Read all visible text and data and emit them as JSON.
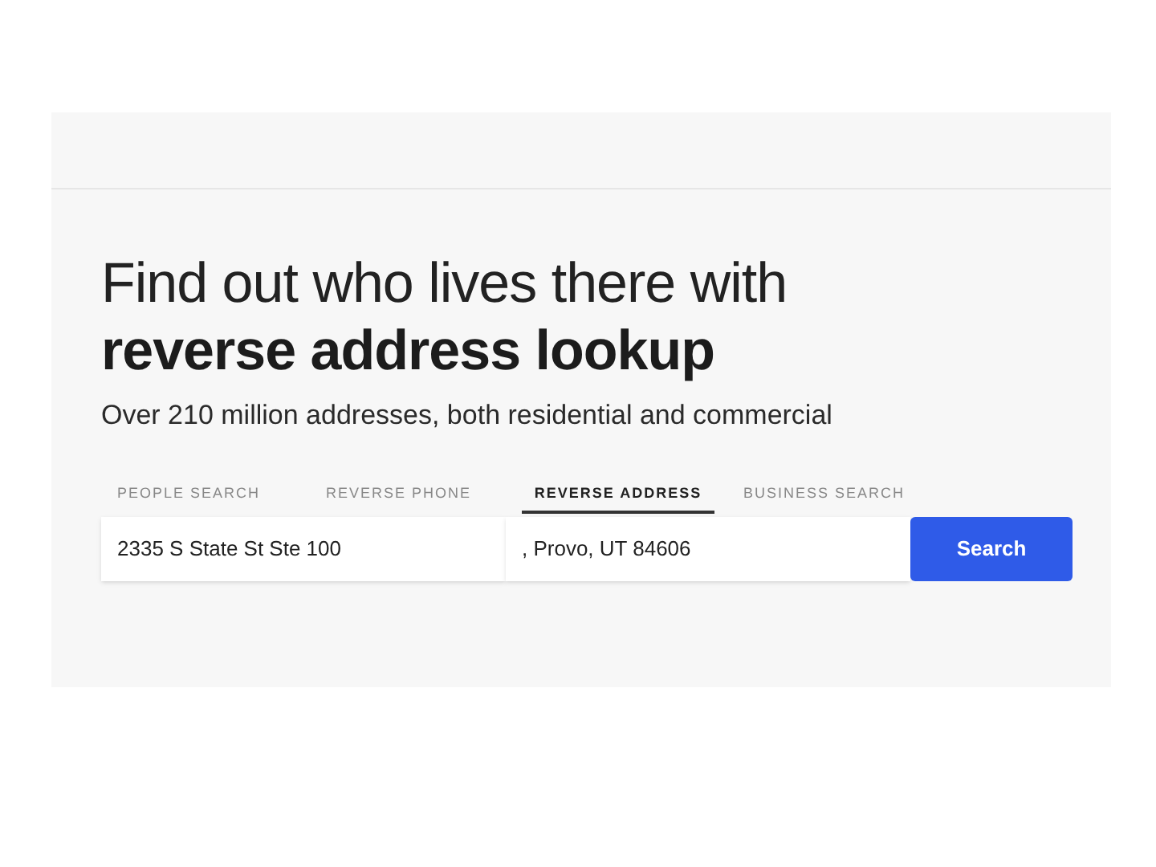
{
  "hero": {
    "title_line": "Find out who lives there with",
    "title_bold_line": "reverse address lookup",
    "subtitle": "Over 210 million addresses, both residential and commercial"
  },
  "tabs": [
    {
      "label": "PEOPLE SEARCH",
      "selected": false
    },
    {
      "label": "REVERSE PHONE",
      "selected": false
    },
    {
      "label": "REVERSE ADDRESS",
      "selected": true
    },
    {
      "label": "BUSINESS SEARCH",
      "selected": false
    }
  ],
  "search": {
    "street_value": "2335 S State St Ste 100",
    "city_value": ", Provo, UT 84606",
    "button": "Search"
  }
}
